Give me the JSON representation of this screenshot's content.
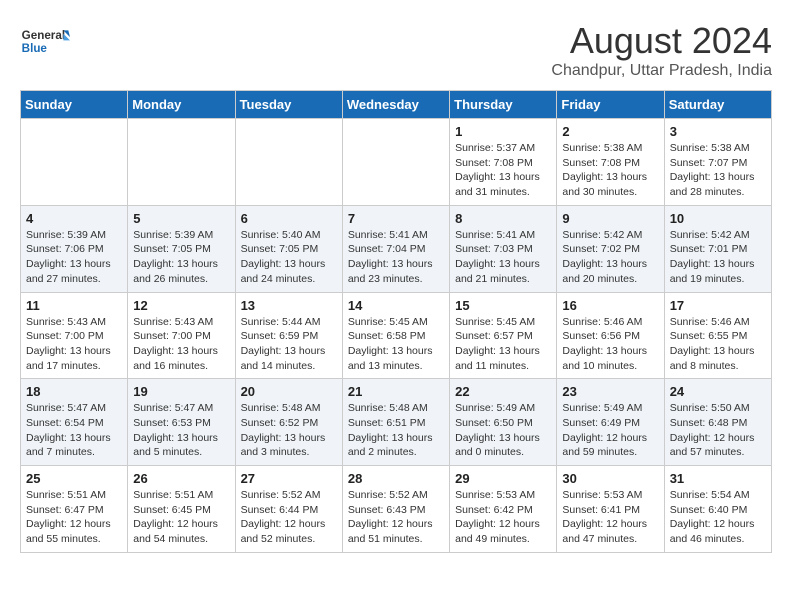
{
  "header": {
    "logo_line1": "General",
    "logo_line2": "Blue",
    "title": "August 2024",
    "subtitle": "Chandpur, Uttar Pradesh, India"
  },
  "calendar": {
    "days_of_week": [
      "Sunday",
      "Monday",
      "Tuesday",
      "Wednesday",
      "Thursday",
      "Friday",
      "Saturday"
    ],
    "weeks": [
      [
        {
          "day": "",
          "info": ""
        },
        {
          "day": "",
          "info": ""
        },
        {
          "day": "",
          "info": ""
        },
        {
          "day": "",
          "info": ""
        },
        {
          "day": "1",
          "info": "Sunrise: 5:37 AM\nSunset: 7:08 PM\nDaylight: 13 hours\nand 31 minutes."
        },
        {
          "day": "2",
          "info": "Sunrise: 5:38 AM\nSunset: 7:08 PM\nDaylight: 13 hours\nand 30 minutes."
        },
        {
          "day": "3",
          "info": "Sunrise: 5:38 AM\nSunset: 7:07 PM\nDaylight: 13 hours\nand 28 minutes."
        }
      ],
      [
        {
          "day": "4",
          "info": "Sunrise: 5:39 AM\nSunset: 7:06 PM\nDaylight: 13 hours\nand 27 minutes."
        },
        {
          "day": "5",
          "info": "Sunrise: 5:39 AM\nSunset: 7:05 PM\nDaylight: 13 hours\nand 26 minutes."
        },
        {
          "day": "6",
          "info": "Sunrise: 5:40 AM\nSunset: 7:05 PM\nDaylight: 13 hours\nand 24 minutes."
        },
        {
          "day": "7",
          "info": "Sunrise: 5:41 AM\nSunset: 7:04 PM\nDaylight: 13 hours\nand 23 minutes."
        },
        {
          "day": "8",
          "info": "Sunrise: 5:41 AM\nSunset: 7:03 PM\nDaylight: 13 hours\nand 21 minutes."
        },
        {
          "day": "9",
          "info": "Sunrise: 5:42 AM\nSunset: 7:02 PM\nDaylight: 13 hours\nand 20 minutes."
        },
        {
          "day": "10",
          "info": "Sunrise: 5:42 AM\nSunset: 7:01 PM\nDaylight: 13 hours\nand 19 minutes."
        }
      ],
      [
        {
          "day": "11",
          "info": "Sunrise: 5:43 AM\nSunset: 7:00 PM\nDaylight: 13 hours\nand 17 minutes."
        },
        {
          "day": "12",
          "info": "Sunrise: 5:43 AM\nSunset: 7:00 PM\nDaylight: 13 hours\nand 16 minutes."
        },
        {
          "day": "13",
          "info": "Sunrise: 5:44 AM\nSunset: 6:59 PM\nDaylight: 13 hours\nand 14 minutes."
        },
        {
          "day": "14",
          "info": "Sunrise: 5:45 AM\nSunset: 6:58 PM\nDaylight: 13 hours\nand 13 minutes."
        },
        {
          "day": "15",
          "info": "Sunrise: 5:45 AM\nSunset: 6:57 PM\nDaylight: 13 hours\nand 11 minutes."
        },
        {
          "day": "16",
          "info": "Sunrise: 5:46 AM\nSunset: 6:56 PM\nDaylight: 13 hours\nand 10 minutes."
        },
        {
          "day": "17",
          "info": "Sunrise: 5:46 AM\nSunset: 6:55 PM\nDaylight: 13 hours\nand 8 minutes."
        }
      ],
      [
        {
          "day": "18",
          "info": "Sunrise: 5:47 AM\nSunset: 6:54 PM\nDaylight: 13 hours\nand 7 minutes."
        },
        {
          "day": "19",
          "info": "Sunrise: 5:47 AM\nSunset: 6:53 PM\nDaylight: 13 hours\nand 5 minutes."
        },
        {
          "day": "20",
          "info": "Sunrise: 5:48 AM\nSunset: 6:52 PM\nDaylight: 13 hours\nand 3 minutes."
        },
        {
          "day": "21",
          "info": "Sunrise: 5:48 AM\nSunset: 6:51 PM\nDaylight: 13 hours\nand 2 minutes."
        },
        {
          "day": "22",
          "info": "Sunrise: 5:49 AM\nSunset: 6:50 PM\nDaylight: 13 hours\nand 0 minutes."
        },
        {
          "day": "23",
          "info": "Sunrise: 5:49 AM\nSunset: 6:49 PM\nDaylight: 12 hours\nand 59 minutes."
        },
        {
          "day": "24",
          "info": "Sunrise: 5:50 AM\nSunset: 6:48 PM\nDaylight: 12 hours\nand 57 minutes."
        }
      ],
      [
        {
          "day": "25",
          "info": "Sunrise: 5:51 AM\nSunset: 6:47 PM\nDaylight: 12 hours\nand 55 minutes."
        },
        {
          "day": "26",
          "info": "Sunrise: 5:51 AM\nSunset: 6:45 PM\nDaylight: 12 hours\nand 54 minutes."
        },
        {
          "day": "27",
          "info": "Sunrise: 5:52 AM\nSunset: 6:44 PM\nDaylight: 12 hours\nand 52 minutes."
        },
        {
          "day": "28",
          "info": "Sunrise: 5:52 AM\nSunset: 6:43 PM\nDaylight: 12 hours\nand 51 minutes."
        },
        {
          "day": "29",
          "info": "Sunrise: 5:53 AM\nSunset: 6:42 PM\nDaylight: 12 hours\nand 49 minutes."
        },
        {
          "day": "30",
          "info": "Sunrise: 5:53 AM\nSunset: 6:41 PM\nDaylight: 12 hours\nand 47 minutes."
        },
        {
          "day": "31",
          "info": "Sunrise: 5:54 AM\nSunset: 6:40 PM\nDaylight: 12 hours\nand 46 minutes."
        }
      ]
    ]
  }
}
